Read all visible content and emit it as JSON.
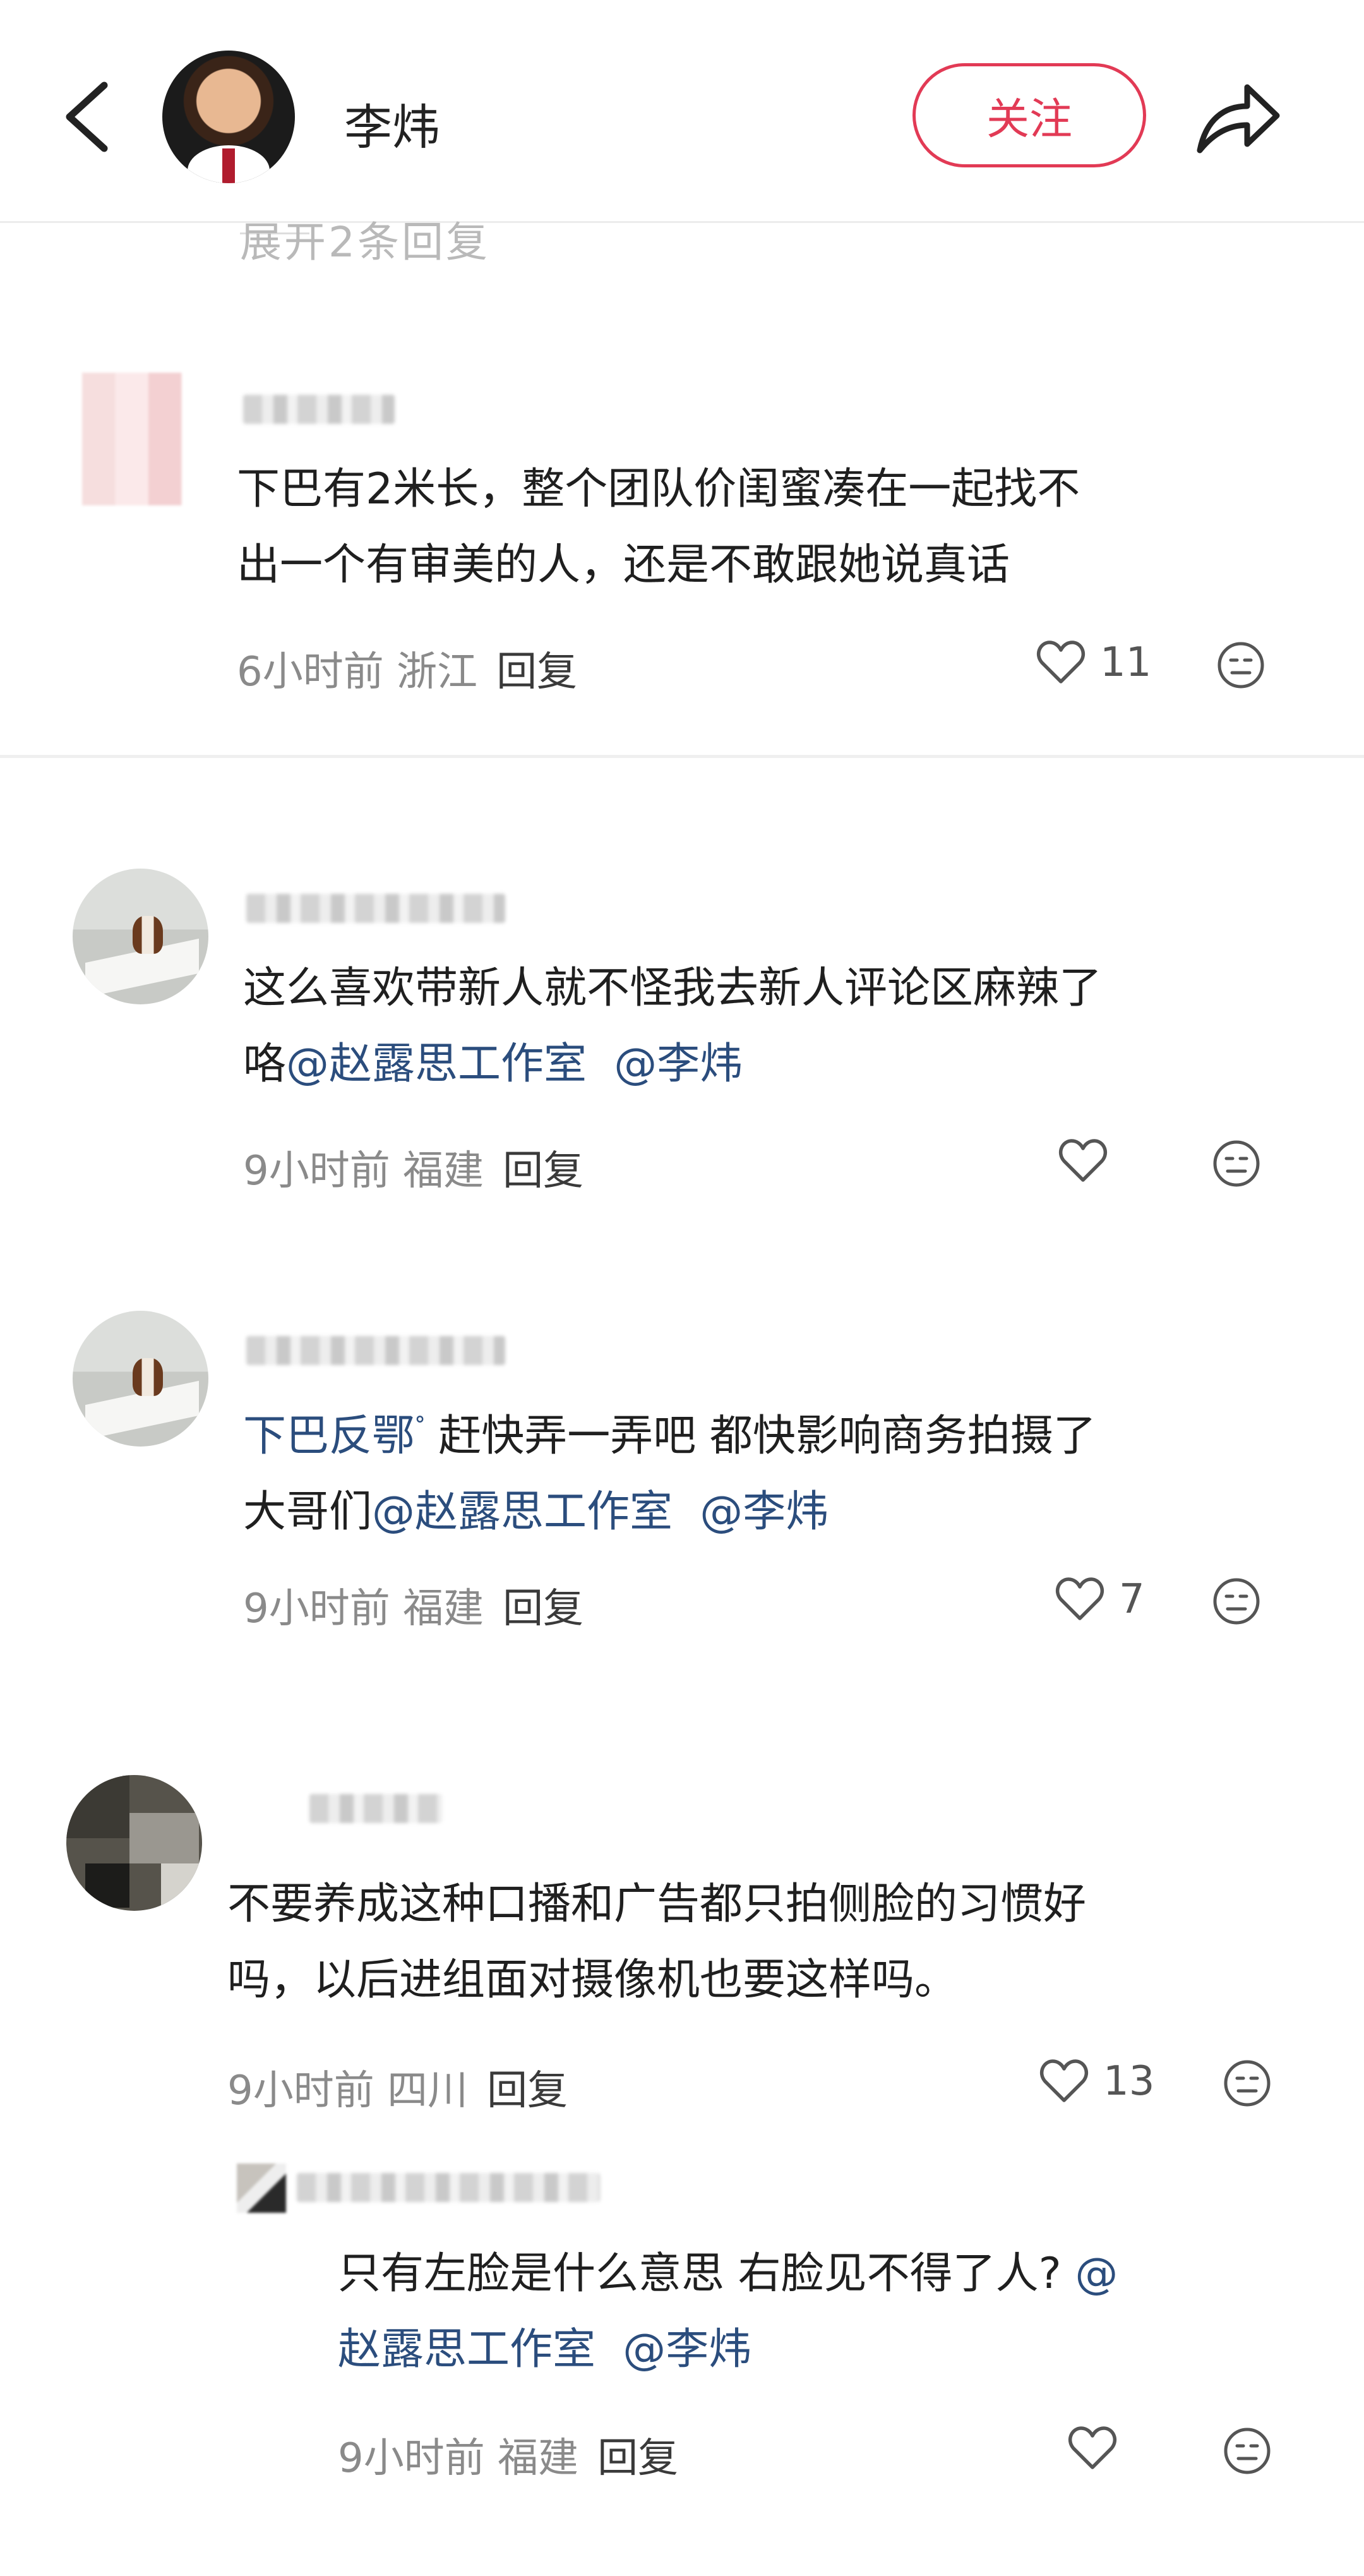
{
  "header": {
    "name": "李炜",
    "follow_label": "关注"
  },
  "partial_top": {
    "text": "展开2条回复"
  },
  "comments": [
    {
      "text_plain": "下巴有2米长，整个团队价闺蜜凑在一起找不出一个有审美的人，还是不敢跟她说真话",
      "line1": "下巴有2米长，整个团队价闺蜜凑在一起找不",
      "line2": "出一个有审美的人，还是不敢跟她说真话",
      "time": "6小时前",
      "region": "浙江",
      "reply": "回复",
      "likes": "11"
    },
    {
      "line1": "这么喜欢带新人就不怪我去新人评论区麻辣了",
      "line2_pre": "咯",
      "mention1": "@赵露思工作室",
      "mention2": "@李炜",
      "time": "9小时前",
      "region": "福建",
      "reply": "回复",
      "likes": ""
    },
    {
      "topic": "下巴反鄂",
      "topic_mark": "ᐤ",
      "line1_rest": " 赶快弄一弄吧 都快影响商务拍摄了",
      "line2_pre": "大哥们",
      "mention1": "@赵露思工作室",
      "mention2": "@李炜",
      "time": "9小时前",
      "region": "福建",
      "reply": "回复",
      "likes": "7"
    },
    {
      "line1": "不要养成这种口播和广告都只拍侧脸的习惯好",
      "line2": "吗，以后进组面对摄像机也要这样吗。",
      "time": "9小时前",
      "region": "四川",
      "reply": "回复",
      "likes": "13"
    },
    {
      "line1_pre": "只有左脸是什么意思 右脸见不得了人?",
      "line1_at": " @",
      "mention1": "赵露思工作室",
      "mention2": "@李炜",
      "time": "9小时前",
      "region": "福建",
      "reply": "回复",
      "likes": ""
    }
  ],
  "icons": {
    "back": "chevron-left-icon",
    "share": "share-arrow-icon",
    "like": "heart-icon",
    "dislike": "meh-face-icon"
  },
  "colors": {
    "accent": "#e23a55",
    "mention": "#2b4d7d",
    "meta": "#8a8a8a"
  }
}
